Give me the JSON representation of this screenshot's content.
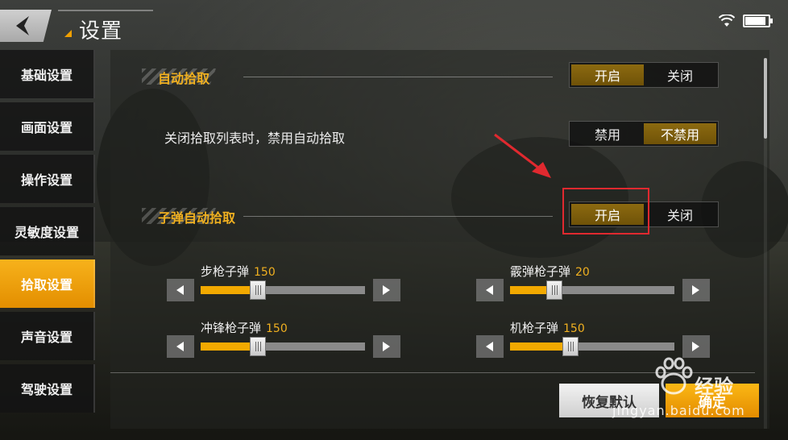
{
  "header": {
    "title": "设置",
    "back_icon": "back-arrow-icon"
  },
  "status_bar": {
    "wifi_icon": "wifi-icon",
    "battery_icon": "battery-icon",
    "battery_level": 0.9
  },
  "sidebar": {
    "items": [
      {
        "label": "基础设置",
        "active": false
      },
      {
        "label": "画面设置",
        "active": false
      },
      {
        "label": "操作设置",
        "active": false
      },
      {
        "label": "灵敏度设置",
        "active": false
      },
      {
        "label": "拾取设置",
        "active": true
      },
      {
        "label": "声音设置",
        "active": false
      },
      {
        "label": "驾驶设置",
        "active": false
      }
    ]
  },
  "sections": {
    "auto_pickup": {
      "label": "自动拾取",
      "options": [
        "开启",
        "关闭"
      ],
      "selected": "开启"
    },
    "disable_when_list_closed": {
      "label": "关闭拾取列表时，禁用自动拾取",
      "options": [
        "禁用",
        "不禁用"
      ],
      "selected": "不禁用"
    },
    "ammo_auto_pickup": {
      "label": "子弹自动拾取",
      "options": [
        "开启",
        "关闭"
      ],
      "selected": "开启"
    }
  },
  "sliders": [
    {
      "label": "步枪子弹",
      "value": "150",
      "level": 0.35
    },
    {
      "label": "霰弹枪子弹",
      "value": "20",
      "level": 0.27
    },
    {
      "label": "冲锋枪子弹",
      "value": "150",
      "level": 0.35
    },
    {
      "label": "机枪子弹",
      "value": "150",
      "level": 0.37
    }
  ],
  "buttons": {
    "reset": "恢复默认",
    "confirm": "确定"
  },
  "watermark": {
    "brand": "经验",
    "url": "jingyan.baidu.com",
    "logo_icon": "baidu-paw-icon"
  },
  "colors": {
    "accent": "#f2a900",
    "toggle_on": "#7d5e0c",
    "highlight": "#e0292f"
  }
}
